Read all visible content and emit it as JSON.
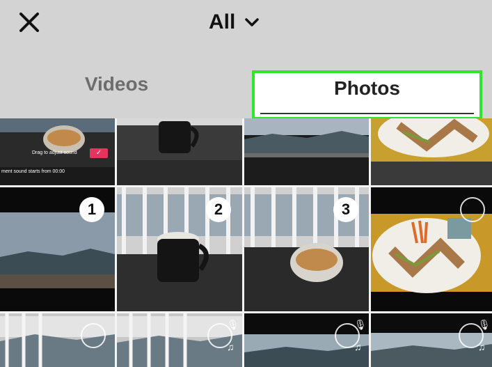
{
  "header": {
    "close_icon": "close-icon",
    "album_label": "All",
    "album_chevron": "chevron-down-icon"
  },
  "tabs": [
    {
      "label": "Videos",
      "active": false
    },
    {
      "label": "Photos",
      "active": true
    }
  ],
  "colors": {
    "highlight": "#2ee62e",
    "background": "#d3d3d3",
    "badge": "#ffffff",
    "confirm": "#e8345c"
  },
  "grid": {
    "overlay": {
      "drag_hint": "Drag to adjust sound",
      "sound_start": "ment sound starts from 00:00"
    },
    "selected_badges": [
      "1",
      "2",
      "3"
    ]
  }
}
